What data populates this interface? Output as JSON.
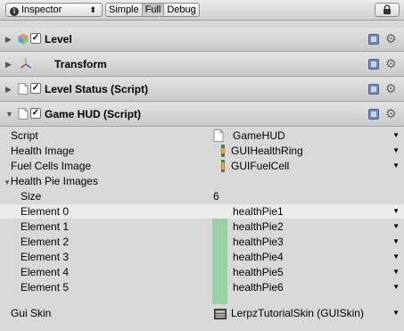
{
  "toolbar": {
    "inspector_label": "Inspector",
    "modes": [
      "Simple",
      "Full",
      "Debug"
    ],
    "active_mode": "Full"
  },
  "components": [
    {
      "title": "Level",
      "checked": true,
      "icon": "gameobject-cube-icon"
    },
    {
      "title": "Transform",
      "icon": "transform-axes-icon"
    },
    {
      "title": "Level Status (Script)",
      "checked": true,
      "icon": "script-file-icon"
    },
    {
      "title": "Game HUD (Script)",
      "checked": true,
      "icon": "script-file-icon",
      "expanded": true
    }
  ],
  "properties": {
    "script": {
      "label": "Script",
      "value": "GameHUD",
      "icon": "script-file-icon"
    },
    "health_image": {
      "label": "Health Image",
      "value": "GUIHealthRing",
      "icon": "texture-icon"
    },
    "fuel_cells_image": {
      "label": "Fuel Cells Image",
      "value": "GUIFuelCell",
      "icon": "texture-icon"
    },
    "health_pie_images": {
      "label": "Health Pie Images",
      "expanded": true
    },
    "size": {
      "label": "Size",
      "value": "6"
    },
    "elements": [
      {
        "label": "Element 0",
        "value": "healthPie1"
      },
      {
        "label": "Element 1",
        "value": "healthPie2"
      },
      {
        "label": "Element 2",
        "value": "healthPie3"
      },
      {
        "label": "Element 3",
        "value": "healthPie4"
      },
      {
        "label": "Element 4",
        "value": "healthPie5"
      },
      {
        "label": "Element 5",
        "value": "healthPie6"
      }
    ],
    "gui_skin": {
      "label": "Gui Skin",
      "value": "LerpzTutorialSkin (GUISkin)",
      "icon": "guiskin-icon"
    }
  },
  "colors": {
    "array_highlight": "#9bcfa4",
    "selected_row": "#ebebeb"
  }
}
